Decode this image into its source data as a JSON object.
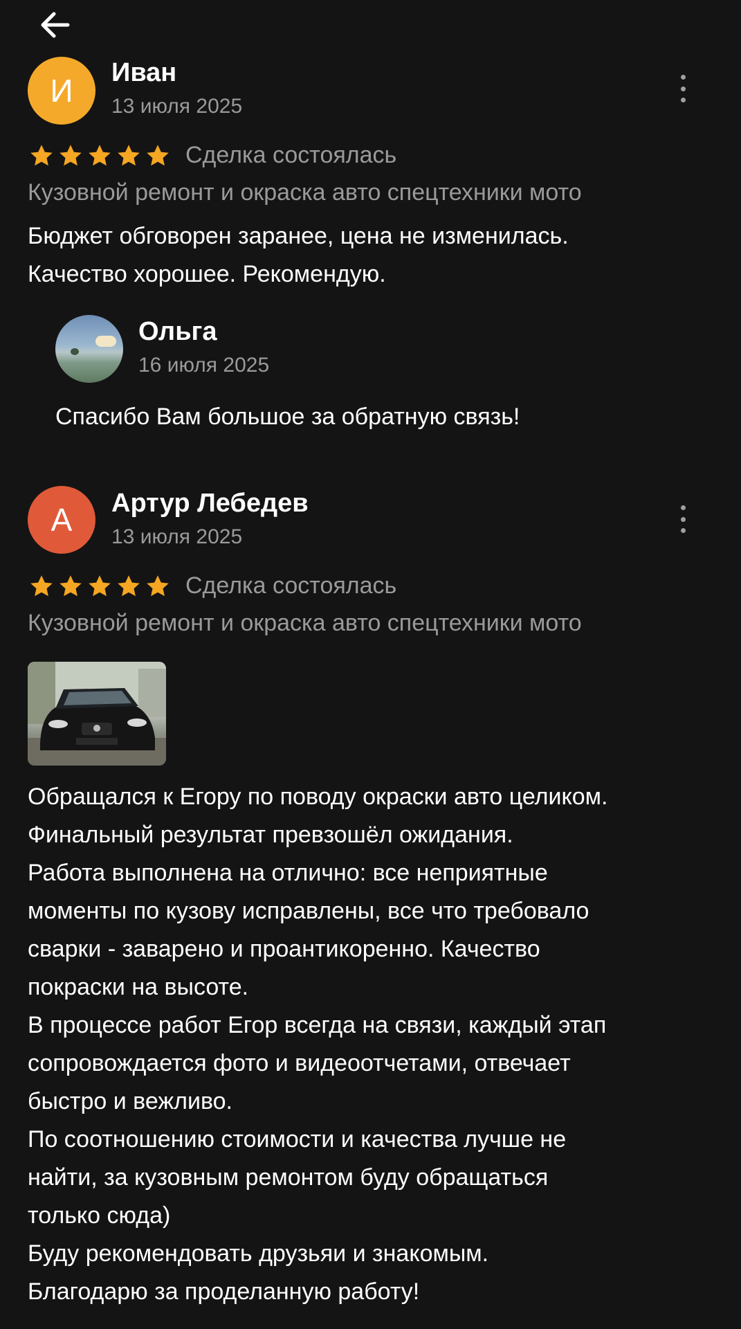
{
  "header": {
    "back_icon": "arrow-left-icon"
  },
  "colors": {
    "background": "#141414",
    "star": "#f5a623",
    "muted": "#9a9a9a",
    "avatar_ivan": "#f5a92b",
    "avatar_artur": "#e05a3a"
  },
  "reviews": [
    {
      "avatar_letter": "И",
      "author": "Иван",
      "date": "13 июля 2025",
      "rating": 5,
      "deal_status": "Сделка состоялась",
      "category": "Кузовной ремонт и окраска авто спецтехники мото",
      "text_lines": [
        "Бюджет обговорен заранее, цена не изменилась.",
        "Качество хорошее. Рекомендую."
      ],
      "reply": {
        "author": "Ольга",
        "date": "16 июля 2025",
        "text": "Спасибо Вам большое за обратную связь!"
      }
    },
    {
      "avatar_letter": "А",
      "author": "Артур Лебедев",
      "date": "13 июля 2025",
      "rating": 5,
      "deal_status": "Сделка состоялась",
      "category": "Кузовной ремонт и окраска авто спецтехники мото",
      "text_lines": [
        "Обращался к Егору по поводу окраски авто целиком.",
        "Финальный результат превзошёл ожидания.",
        "Работа выполнена на отлично: все неприятные",
        "моменты по кузову исправлены, все что требовало",
        "сварки - заварено и проантикоренно. Качество",
        "покраски на высоте.",
        "В процессе работ Егор всегда на связи, каждый этап",
        "сопровождается фото и видеоотчетами, отвечает",
        "быстро и вежливо.",
        "По соотношению стоимости и качества лучше не",
        "найти, за кузовным ремонтом буду обращаться",
        "только сюда)",
        "Буду рекомендовать друзьяи и знакомым.",
        "Благодарю за проделанную работу!"
      ]
    }
  ]
}
